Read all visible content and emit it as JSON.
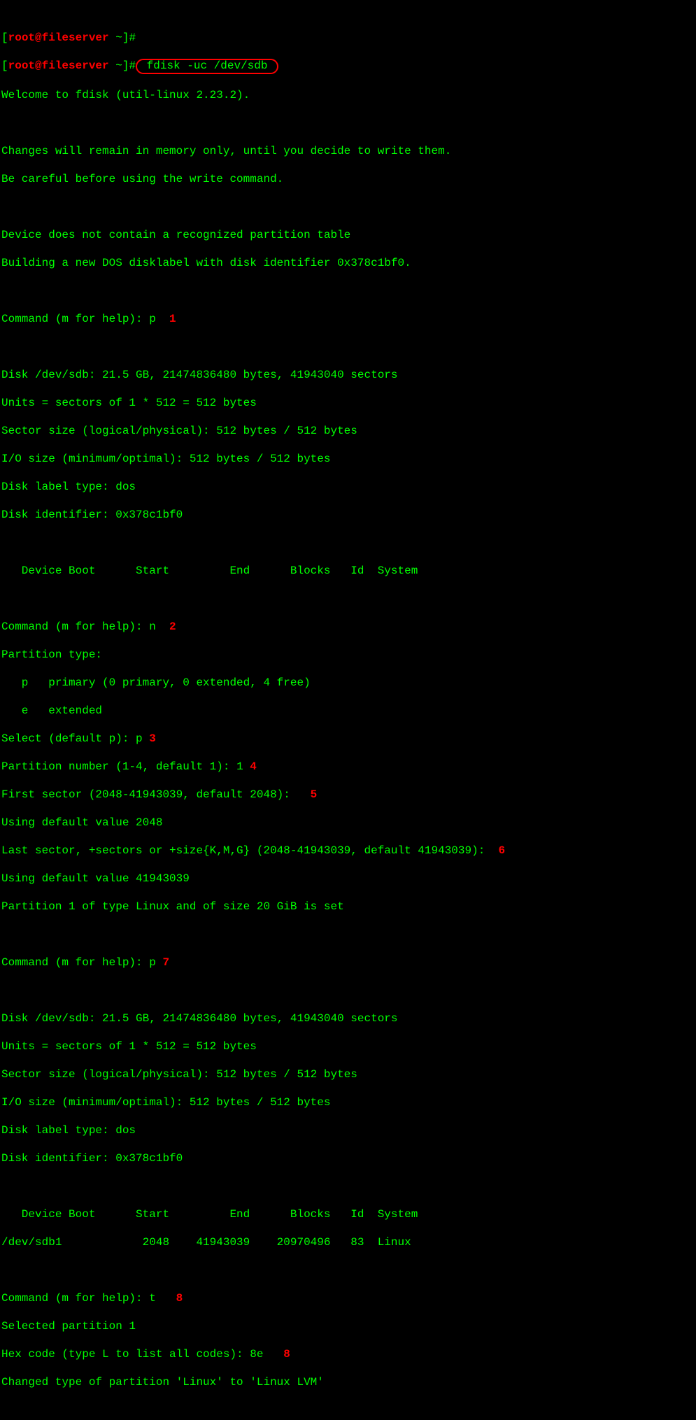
{
  "prompt": {
    "open_bracket": "[",
    "close_bracket_hash": "]#",
    "userhost": "root@fileserver ",
    "cwd": "~",
    "cmd1": " ",
    "cmd2_boxed": " fdisk -uc /dev/sdb "
  },
  "welcome": "Welcome to fdisk (util-linux 2.23.2).",
  "changes1": "Changes will remain in memory only, until you decide to write them.",
  "changes2": "Be careful before using the write command.",
  "nodev1": "Device does not contain a recognized partition table",
  "nodev2": "Building a new DOS disklabel with disk identifier 0x378c1bf0.",
  "cmd_help_prompt": "Command (m for help): ",
  "in_p1": "p",
  "an1": "  1",
  "disk_info": {
    "l1": "Disk /dev/sdb: 21.5 GB, 21474836480 bytes, 41943040 sectors",
    "l2": "Units = sectors of 1 * 512 = 512 bytes",
    "l3": "Sector size (logical/physical): 512 bytes / 512 bytes",
    "l4": "I/O size (minimum/optimal): 512 bytes / 512 bytes",
    "l5": "Disk label type: dos",
    "l6": "Disk identifier: 0x378c1bf0"
  },
  "table_header": "   Device Boot      Start         End      Blocks   Id  System",
  "in_n": "n",
  "an2": "  2",
  "ptype_l1": "Partition type:",
  "ptype_l2": "   p   primary (0 primary, 0 extended, 4 free)",
  "ptype_l3": "   e   extended",
  "select_prompt": "Select (default p): ",
  "in_select": "p",
  "an3": " 3",
  "partnum_prompt": "Partition number (1-4, default 1): ",
  "in_partnum": "1",
  "an4": " 4",
  "firstsec_prompt": "First sector (2048-41943039, default 2048): ",
  "an5": "  5",
  "using_default1": "Using default value 2048",
  "lastsec_prompt": "Last sector, +sectors or +size{K,M,G} (2048-41943039, default 41943039): ",
  "an6": " 6",
  "using_default2": "Using default value 41943039",
  "part_set": "Partition 1 of type Linux and of size 20 GiB is set",
  "in_p2": "p",
  "an7": " 7",
  "table_row": "/dev/sdb1            2048    41943039    20970496   83  Linux",
  "in_t": "t",
  "an8": "   8",
  "selected_part": "Selected partition 1",
  "hex_prompt": "Hex code (type L to list all codes): ",
  "in_hex": "8e",
  "an8b": "   8",
  "changed_type": "Changed type of partition 'Linux' to 'Linux LVM'"
}
